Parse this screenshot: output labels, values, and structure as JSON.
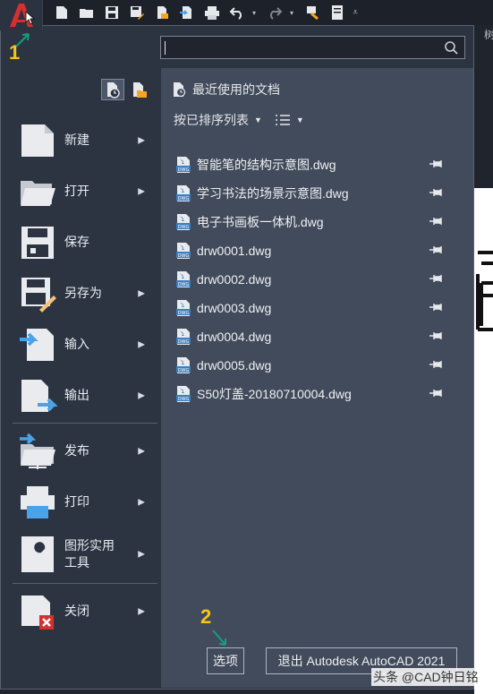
{
  "app": {
    "logo_letter": "A"
  },
  "toolbar": {
    "icons": [
      "new-icon",
      "open-icon",
      "save-icon",
      "save-as-icon",
      "open-from-web-icon",
      "save-to-web-icon",
      "plot-icon",
      "undo-icon",
      "redo-icon",
      "match-properties-icon",
      "sheet-set-icon",
      "customize-icon"
    ],
    "tab_fragment": "树"
  },
  "annotations": {
    "one": "1",
    "two": "2"
  },
  "search": {
    "value": "",
    "placeholder": ""
  },
  "menu": {
    "items": [
      {
        "label": "新建"
      },
      {
        "label": "打开"
      },
      {
        "label": "保存"
      },
      {
        "label": "另存为"
      },
      {
        "label": "输入"
      },
      {
        "label": "输出"
      },
      {
        "label": "发布"
      },
      {
        "label": "打印"
      },
      {
        "label": "图形实用\n工具"
      },
      {
        "label": "关闭"
      }
    ]
  },
  "recent": {
    "title": "最近使用的文档",
    "sort_label": "按已排序列表",
    "files": [
      "智能笔的结构示意图.dwg",
      "学习书法的场景示意图.dwg",
      "电子书画板一体机.dwg",
      "drw0001.dwg",
      "drw0002.dwg",
      "drw0003.dwg",
      "drw0004.dwg",
      "drw0005.dwg",
      "S50灯盖-20180710004.dwg"
    ]
  },
  "buttons": {
    "options": "选项",
    "exit": "退出 Autodesk AutoCAD 2021"
  },
  "watermark": "头条 @CAD钟日铭",
  "colors": {
    "accent_red": "#d62f2f",
    "annotation_yellow": "#f5c518",
    "pane_bg": "#424b5b",
    "menu_bg": "#2c3442"
  }
}
